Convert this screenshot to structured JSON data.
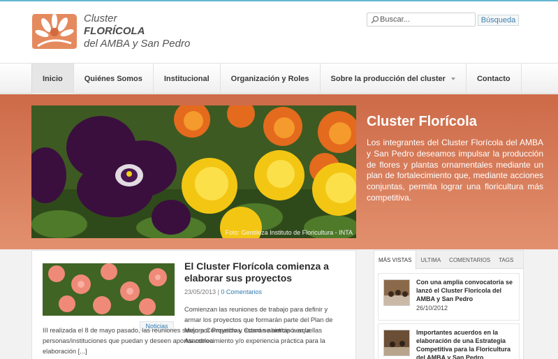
{
  "header": {
    "logo_line1": "Cluster",
    "logo_line2": "FLORÍCOLA",
    "logo_line3": "del AMBA y San Pedro",
    "search_placeholder": "Buscar...",
    "search_button": "Búsqueda"
  },
  "nav": {
    "items": [
      "Inicio",
      "Quiénes Somos",
      "Institucional",
      "Organización y Roles",
      "Sobre la producción del cluster",
      "Contacto"
    ]
  },
  "banner": {
    "title": "Cluster Florícola",
    "text": "Los integrantes del Cluster Florícola del AMBA y San Pedro deseamos impulsar la producción de flores y plantas ornamentales mediante un plan de fortalecimiento que, mediante acciones conjuntas, permita lograr una floricultura más competitiva.",
    "credit": "Foto: Gentileza Instituto de Floricultura - INTA"
  },
  "post": {
    "title": "El Cluster Florícola comienza a elaborar sus proyectos",
    "date": "23/05/2013",
    "separator": "|",
    "comments": "0 Comentarios",
    "tag": "Noticias",
    "excerpt_a": "Comienzan las  reuniones de trabajo para definir y armar  los proyectos que formarán parte del Plan de Mejora Competitiva. Como se anticipó en la Asamblea",
    "excerpt_b": "III realizada el 8 de mayo pasado, las reuniones serán por Proyecto y estarán abiertas a aquellas personas/instituciones que puedan y deseen aportar conocimiento y/o experiencia práctica para la elaboración [...]"
  },
  "sidebar": {
    "tabs": [
      "MÁS VISTAS",
      "ULTIMA",
      "COMENTARIOS",
      "TAGS"
    ],
    "items": [
      {
        "title": "Con una amplia convocatoria se lanzó el Cluster Florícola del AMBA y San Pedro",
        "date": "26/10/2012"
      },
      {
        "title": "Importantes acuerdos en la elaboración de una Estrategia Competitiva para la Floricultura del AMBA y San Pedro",
        "date": ""
      }
    ]
  },
  "colors": {
    "accent": "#63b6cf",
    "banner": "#d67553",
    "link": "#2f7ab0"
  }
}
